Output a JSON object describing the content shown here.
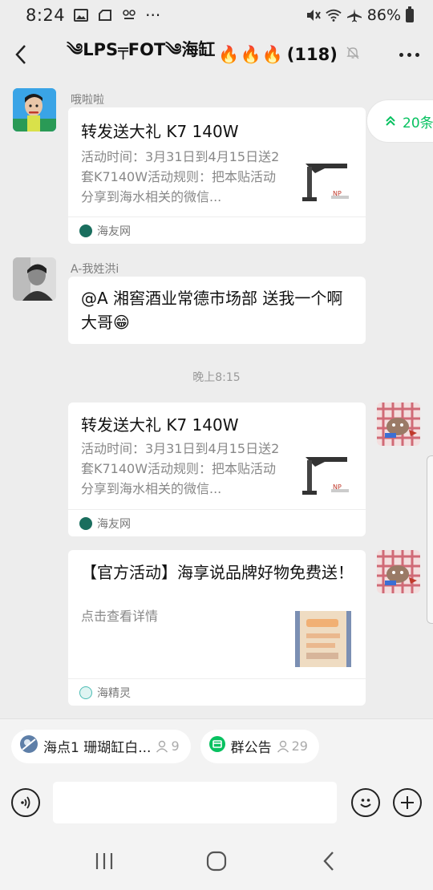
{
  "status_bar": {
    "time": "8:24",
    "battery": "86%",
    "overflow": "···"
  },
  "header": {
    "title": "༄LPS╤FOT༄海缸",
    "flames": "🔥🔥🔥",
    "count": "(118)"
  },
  "float_tag": {
    "label": "20条"
  },
  "messages": [
    {
      "sender": "哦啦啦",
      "card": {
        "title": "转发送大礼 K7 140W",
        "desc": "活动时间：3月31日到4月15日送2套K7140W活动规则：把本贴活动分享到海水相关的微信...",
        "source": "海友网"
      }
    },
    {
      "sender": "A-我姓洪i",
      "text": "@A 湘窖酒业常德市场部  送我一个啊大哥😁"
    },
    {
      "time": "晚上8:15"
    },
    {
      "self": true,
      "card": {
        "title": "转发送大礼 K7 140W",
        "desc": "活动时间：3月31日到4月15日送2套K7140W活动规则：把本贴活动分享到海水相关的微信...",
        "source": "海友网"
      }
    },
    {
      "self": true,
      "card": {
        "title": "【官方活动】海享说品牌好物免费送！",
        "desc": "点击查看详情",
        "source": "海精灵"
      }
    }
  ],
  "chips": [
    {
      "label": "海点1 珊瑚缸白...",
      "count": "9"
    },
    {
      "label": "群公告",
      "count": "29"
    }
  ],
  "input": {
    "placeholder": ""
  },
  "colors": {
    "accent": "#07c160",
    "background": "#ededed"
  },
  "icons": [
    "back-icon",
    "mute-icon",
    "more-icon",
    "voice-icon",
    "emoji-icon",
    "add-icon",
    "recents-icon",
    "home-icon",
    "nav-back-icon"
  ]
}
